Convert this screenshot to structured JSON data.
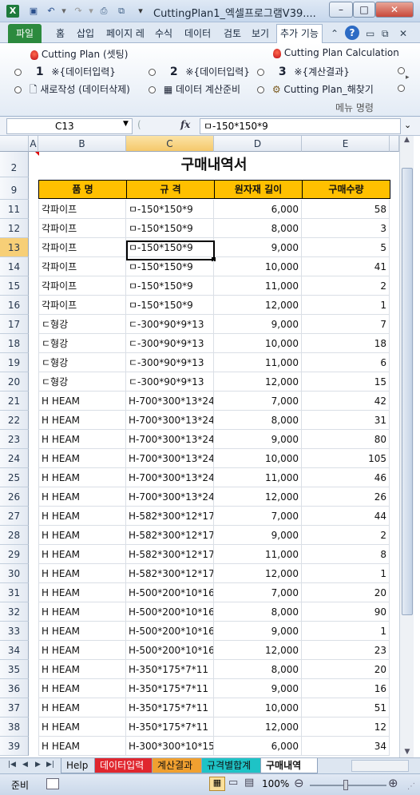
{
  "window": {
    "title": "CuttingPlan1_엑셀프로그램V39....",
    "app_icon": "X",
    "minimize": "–",
    "maximize": "□",
    "close": "✕"
  },
  "menu": {
    "tabs": [
      "파일",
      "홈",
      "삽입",
      "페이지 레",
      "수식",
      "데이터",
      "검토",
      "보기",
      "추가 기능"
    ]
  },
  "ribbon": {
    "cp_setting": "Cutting Plan (셋팅)",
    "cp_calc": "Cutting Plan Calculation",
    "step1_num": "1",
    "step1": "※{데이터입력}",
    "step2_num": "2",
    "step2": "※{데이터입력}",
    "step3_num": "3",
    "step3": "※{계산결과}",
    "new": "새로작성 (데이터삭제)",
    "prep": "데이터 계산준비",
    "find": "Cutting Plan_해찾기",
    "group_label": "메뉴 명령"
  },
  "formula_bar": {
    "name_box": "C13",
    "fx": "fx",
    "value": "ㅁ-150*150*9"
  },
  "columns": [
    "A",
    "B",
    "C",
    "D",
    "E"
  ],
  "sheet": {
    "title": "구매내역서",
    "headers": [
      "품 명",
      "규 격",
      "원자재 길이",
      "구매수량"
    ],
    "rows": [
      {
        "r": "11",
        "name": "각파이프",
        "spec": "ㅁ-150*150*9",
        "len": "6,000",
        "qty": "58"
      },
      {
        "r": "12",
        "name": "각파이프",
        "spec": "ㅁ-150*150*9",
        "len": "8,000",
        "qty": "3"
      },
      {
        "r": "13",
        "name": "각파이프",
        "spec": "ㅁ-150*150*9",
        "len": "9,000",
        "qty": "5"
      },
      {
        "r": "14",
        "name": "각파이프",
        "spec": "ㅁ-150*150*9",
        "len": "10,000",
        "qty": "41"
      },
      {
        "r": "15",
        "name": "각파이프",
        "spec": "ㅁ-150*150*9",
        "len": "11,000",
        "qty": "2"
      },
      {
        "r": "16",
        "name": "각파이프",
        "spec": "ㅁ-150*150*9",
        "len": "12,000",
        "qty": "1"
      },
      {
        "r": "17",
        "name": "ㄷ형강",
        "spec": "ㄷ-300*90*9*13",
        "len": "9,000",
        "qty": "7"
      },
      {
        "r": "18",
        "name": "ㄷ형강",
        "spec": "ㄷ-300*90*9*13",
        "len": "10,000",
        "qty": "18"
      },
      {
        "r": "19",
        "name": "ㄷ형강",
        "spec": "ㄷ-300*90*9*13",
        "len": "11,000",
        "qty": "6"
      },
      {
        "r": "20",
        "name": "ㄷ형강",
        "spec": "ㄷ-300*90*9*13",
        "len": "12,000",
        "qty": "15"
      },
      {
        "r": "21",
        "name": "H HEAM",
        "spec": "H-700*300*13*24",
        "len": "7,000",
        "qty": "42"
      },
      {
        "r": "22",
        "name": "H HEAM",
        "spec": "H-700*300*13*24",
        "len": "8,000",
        "qty": "31"
      },
      {
        "r": "23",
        "name": "H HEAM",
        "spec": "H-700*300*13*24",
        "len": "9,000",
        "qty": "80"
      },
      {
        "r": "24",
        "name": "H HEAM",
        "spec": "H-700*300*13*24",
        "len": "10,000",
        "qty": "105"
      },
      {
        "r": "25",
        "name": "H HEAM",
        "spec": "H-700*300*13*24",
        "len": "11,000",
        "qty": "46"
      },
      {
        "r": "26",
        "name": "H HEAM",
        "spec": "H-700*300*13*24",
        "len": "12,000",
        "qty": "26"
      },
      {
        "r": "27",
        "name": "H HEAM",
        "spec": "H-582*300*12*17",
        "len": "7,000",
        "qty": "44"
      },
      {
        "r": "28",
        "name": "H HEAM",
        "spec": "H-582*300*12*17",
        "len": "9,000",
        "qty": "2"
      },
      {
        "r": "29",
        "name": "H HEAM",
        "spec": "H-582*300*12*17",
        "len": "11,000",
        "qty": "8"
      },
      {
        "r": "30",
        "name": "H HEAM",
        "spec": "H-582*300*12*17",
        "len": "12,000",
        "qty": "1"
      },
      {
        "r": "31",
        "name": "H HEAM",
        "spec": "H-500*200*10*16",
        "len": "7,000",
        "qty": "20"
      },
      {
        "r": "32",
        "name": "H HEAM",
        "spec": "H-500*200*10*16",
        "len": "8,000",
        "qty": "90"
      },
      {
        "r": "33",
        "name": "H HEAM",
        "spec": "H-500*200*10*16",
        "len": "9,000",
        "qty": "1"
      },
      {
        "r": "34",
        "name": "H HEAM",
        "spec": "H-500*200*10*16",
        "len": "12,000",
        "qty": "23"
      },
      {
        "r": "35",
        "name": "H HEAM",
        "spec": "H-350*175*7*11",
        "len": "8,000",
        "qty": "20"
      },
      {
        "r": "36",
        "name": "H HEAM",
        "spec": "H-350*175*7*11",
        "len": "9,000",
        "qty": "16"
      },
      {
        "r": "37",
        "name": "H HEAM",
        "spec": "H-350*175*7*11",
        "len": "10,000",
        "qty": "51"
      },
      {
        "r": "38",
        "name": "H HEAM",
        "spec": "H-350*175*7*11",
        "len": "12,000",
        "qty": "12"
      },
      {
        "r": "39",
        "name": "H HEAM",
        "spec": "H-300*300*10*15",
        "len": "6,000",
        "qty": "34"
      }
    ]
  },
  "sheet_tabs": [
    {
      "label": "Help",
      "bg": "#dde6f1",
      "color": "#111"
    },
    {
      "label": "데이터입력",
      "bg": "#e0262e",
      "color": "#ffffff"
    },
    {
      "label": "계산결과",
      "bg": "#f0a030",
      "color": "#111"
    },
    {
      "label": "규격별합계",
      "bg": "#1ec3c6",
      "color": "#111"
    },
    {
      "label": "구매내역",
      "bg": "#ffffff",
      "color": "#111"
    }
  ],
  "status": {
    "ready": "준비",
    "zoom": "100%"
  }
}
